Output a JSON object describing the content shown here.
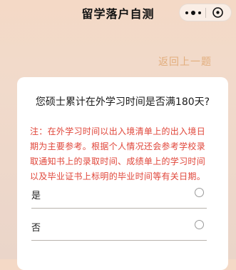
{
  "navbar": {
    "title": "留学落户自测",
    "more_icon": "more-dots-icon",
    "close_icon": "close-circle-icon"
  },
  "back_link": "返回上一题",
  "card": {
    "question": "您硕士累计在外学习时间是否满180天?",
    "note_lines": [
      "注：在外学习时间以出入境清单上的出入境日",
      "期为主要参考。根据个人情况还会参考学校录",
      "取通知书上的录取时间、成绩单上的学习时间",
      "以及毕业证书上标明的毕业时间等有关日期。"
    ],
    "options": [
      {
        "label": "是",
        "selected": false
      },
      {
        "label": "否",
        "selected": false
      }
    ]
  },
  "colors": {
    "accent": "#e2ae7d",
    "note": "#e0463a"
  }
}
